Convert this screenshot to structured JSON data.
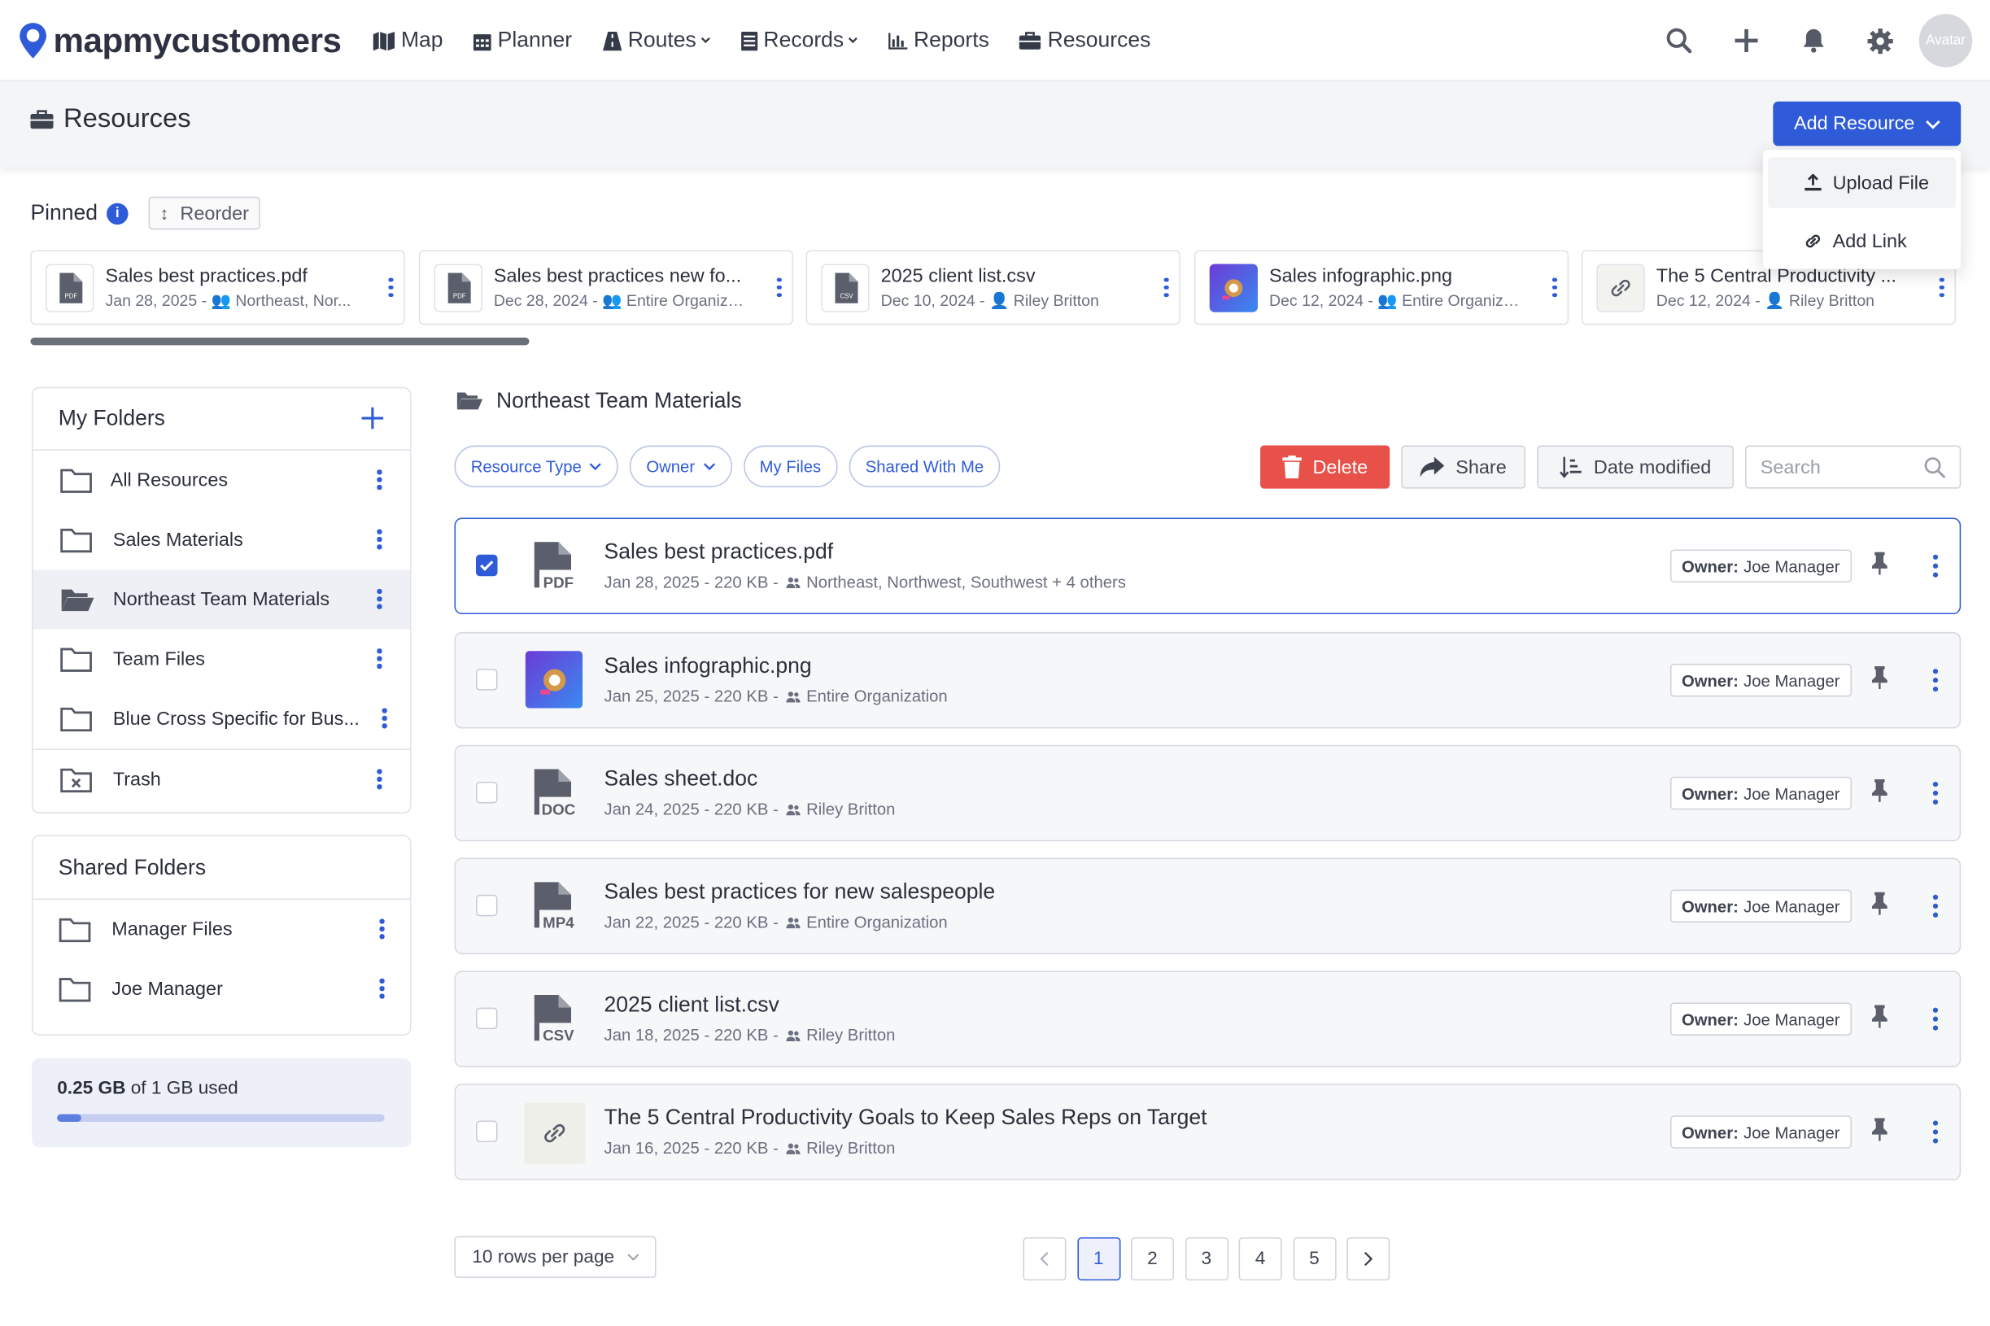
{
  "nav": {
    "brand": "mapmycustomers",
    "items": [
      {
        "label": "Map",
        "icon": "map-icon"
      },
      {
        "label": "Planner",
        "icon": "calendar-icon"
      },
      {
        "label": "Routes",
        "icon": "road-icon"
      },
      {
        "label": "Records",
        "icon": "records-icon"
      },
      {
        "label": "Reports",
        "icon": "chart-icon"
      },
      {
        "label": "Resources",
        "icon": "toolbox-icon"
      }
    ],
    "avatar": "Avatar"
  },
  "header": {
    "title": "Resources",
    "add_button": "Add Resource",
    "dropdown": [
      "Upload File",
      "Add Link"
    ]
  },
  "pinned": {
    "label": "Pinned",
    "info": "i",
    "reorder": "Reorder",
    "cards": [
      {
        "name": "Sales best practices.pdf",
        "date": "Jan 28, 2025 -",
        "share": "Northeast, Nor...",
        "share_icon": "group-icon",
        "type": "pdf"
      },
      {
        "name": "Sales best practices new fo...",
        "date": "Dec 28, 2024 -",
        "share": "Entire Organiza...",
        "share_icon": "group-icon",
        "type": "pdf"
      },
      {
        "name": "2025 client list.csv",
        "date": "Dec 10, 2024 -",
        "share": "Riley Britton",
        "share_icon": "user-icon",
        "type": "csv"
      },
      {
        "name": "Sales infographic.png",
        "date": "Dec 12, 2024 -",
        "share": "Entire Organizat...",
        "share_icon": "group-icon",
        "type": "png"
      },
      {
        "name": "The 5 Central Productivity ...",
        "date": "Dec 12, 2024 -",
        "share": "Riley Britton",
        "share_icon": "user-icon",
        "type": "link"
      }
    ]
  },
  "my_folders": {
    "title": "My Folders",
    "items": [
      "All Resources",
      "Sales Materials",
      "Northeast Team Materials",
      "Team Files",
      "Blue Cross Specific for Bus..."
    ],
    "trash": "Trash",
    "selected": "Northeast Team Materials"
  },
  "shared_folders": {
    "title": "Shared Folders",
    "items": [
      "Manager Files",
      "Joe Manager"
    ]
  },
  "storage": {
    "used": "0.25 GB",
    "total_text": "of 1 GB used",
    "fraction": 0.25
  },
  "main": {
    "folder_title": "Northeast Team Materials",
    "filters": [
      "Resource Type",
      "Owner",
      "My Files",
      "Shared With Me"
    ],
    "delete": "Delete",
    "share": "Share",
    "sort": "Date modified",
    "search_placeholder": "Search",
    "owner_label": "Owner:",
    "rows": [
      {
        "name": "Sales best practices.pdf",
        "meta": "Jan 28, 2025 - 220 KB -",
        "share": "Northeast, Northwest, Southwest + 4 others",
        "owner": "Joe Manager",
        "type": "PDF",
        "checked": true
      },
      {
        "name": "Sales infographic.png",
        "meta": "Jan 25, 2025 - 220 KB -",
        "share": "Entire Organization",
        "owner": "Joe Manager",
        "type": "png",
        "checked": false
      },
      {
        "name": "Sales sheet.doc",
        "meta": "Jan 24, 2025 - 220 KB -",
        "share": "Riley Britton",
        "owner": "Joe Manager",
        "type": "DOC",
        "checked": false
      },
      {
        "name": "Sales best practices for new salespeople",
        "meta": "Jan 22, 2025 - 220 KB -",
        "share": "Entire Organization",
        "owner": "Joe Manager",
        "type": "MP4",
        "checked": false
      },
      {
        "name": "2025 client list.csv",
        "meta": "Jan 18, 2025 - 220 KB -",
        "share": "Riley Britton",
        "owner": "Joe Manager",
        "type": "CSV",
        "checked": false
      },
      {
        "name": "The 5 Central Productivity Goals to Keep Sales Reps on Target",
        "meta": "Jan 16, 2025 - 220 KB -",
        "share": "Riley Britton",
        "owner": "Joe Manager",
        "type": "link",
        "checked": false
      }
    ],
    "rows_per_page": "10 rows per page",
    "pages": [
      "1",
      "2",
      "3",
      "4",
      "5"
    ],
    "current_page": "1"
  },
  "colors": {
    "accent": "#2f5bd8",
    "danger": "#e8514a"
  }
}
